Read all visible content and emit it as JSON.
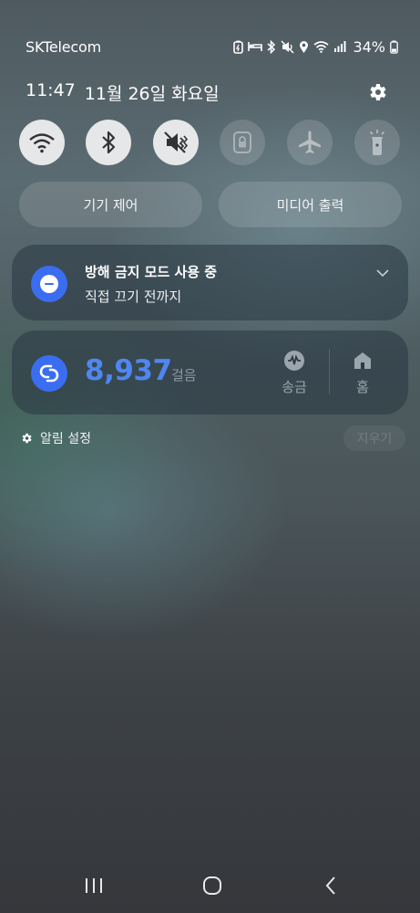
{
  "status_bar": {
    "carrier": "SKTelecom",
    "battery": "34%",
    "icons": [
      "battery-saver-icon",
      "sleep-mode-icon",
      "bluetooth-icon",
      "mute-icon",
      "location-icon",
      "wifi-icon",
      "signal-icon",
      "battery-icon"
    ]
  },
  "header": {
    "time": "11:47",
    "date": "11월 26일 화요일",
    "settings_icon": "gear-icon"
  },
  "quick_tiles": [
    {
      "name": "wifi",
      "icon": "wifi-icon",
      "active": true
    },
    {
      "name": "bluetooth",
      "icon": "bluetooth-icon",
      "active": true
    },
    {
      "name": "sound",
      "icon": "mute-icon",
      "active": true
    },
    {
      "name": "screen-lock",
      "icon": "lock-icon",
      "active": false
    },
    {
      "name": "airplane",
      "icon": "airplane-icon",
      "active": false
    },
    {
      "name": "flashlight",
      "icon": "flashlight-icon",
      "active": false
    }
  ],
  "pills": {
    "device_control": "기기 제어",
    "media_output": "미디어 출력"
  },
  "dnd_notification": {
    "title": "방해 금지 모드 사용 중",
    "subtitle": "직접 끄기 전까지"
  },
  "steps_notification": {
    "count": "8,937",
    "unit": "걸음",
    "actions": [
      {
        "label": "송금",
        "icon": "remittance-icon"
      },
      {
        "label": "홈",
        "icon": "home-icon"
      }
    ]
  },
  "footer": {
    "notification_settings": "알림 설정",
    "clear": "지우기"
  },
  "colors": {
    "accent_blue": "#3a6df0",
    "steps_blue": "#4f86f0",
    "tile_active": "#e6e7e9"
  }
}
